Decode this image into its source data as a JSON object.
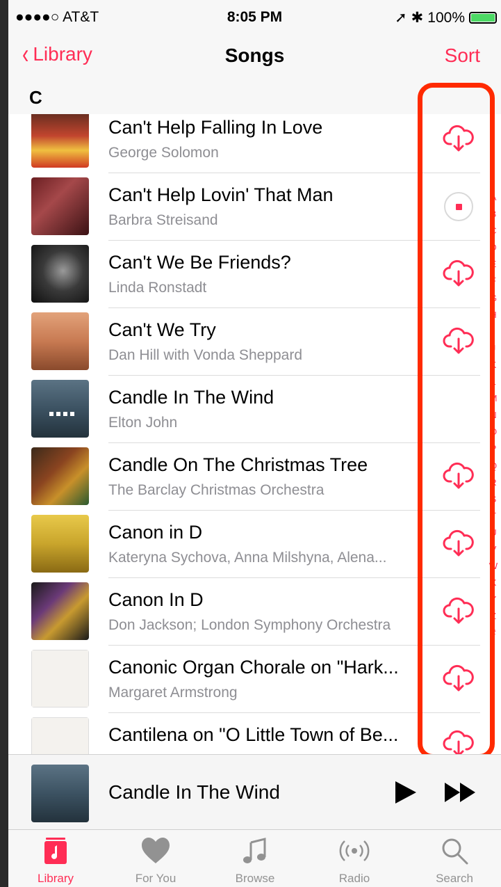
{
  "status_bar": {
    "carrier": "●●●●○ AT&T",
    "time": "8:05 PM",
    "battery": "100%"
  },
  "nav": {
    "back_label": "Library",
    "title": "Songs",
    "sort_label": "Sort"
  },
  "section_header": "C",
  "songs": [
    {
      "title": "Can't Help Falling In Love",
      "artist": "George Solomon",
      "status": "cloud-download-icon"
    },
    {
      "title": "Can't Help Lovin' That Man",
      "artist": "Barbra Streisand",
      "status": "stop-download-icon"
    },
    {
      "title": "Can't We Be Friends?",
      "artist": "Linda Ronstadt",
      "status": "cloud-download-icon"
    },
    {
      "title": "Can't We Try",
      "artist": "Dan Hill with Vonda Sheppard",
      "status": "cloud-download-icon"
    },
    {
      "title": "Candle In The Wind",
      "artist": "Elton John",
      "status": "now-playing-icon"
    },
    {
      "title": "Candle On The Christmas Tree",
      "artist": "The Barclay Christmas Orchestra",
      "status": "cloud-download-icon"
    },
    {
      "title": "Canon in D",
      "artist": "Kateryna Sychova, Anna Milshyna, Alena...",
      "status": "cloud-download-icon"
    },
    {
      "title": "Canon In D",
      "artist": "Don Jackson; London Symphony Orchestra",
      "status": "cloud-download-icon"
    },
    {
      "title": "Canonic Organ Chorale on \"Hark...",
      "artist": "Margaret Armstrong",
      "status": "cloud-download-icon"
    },
    {
      "title": "Cantilena on \"O Little Town of Be...",
      "artist": "",
      "status": "cloud-download-icon"
    }
  ],
  "index_letters": [
    "A",
    "B",
    "C",
    "D",
    "E",
    "F",
    "G",
    "H",
    "I",
    "J",
    "K",
    "L",
    "M",
    "N",
    "O",
    "P",
    "Q",
    "R",
    "S",
    "T",
    "U",
    "V",
    "W",
    "X",
    "Y",
    "Z",
    "#"
  ],
  "mini_player": {
    "title": "Candle In The Wind"
  },
  "tabs": [
    {
      "label": "Library",
      "icon": "library-icon",
      "active": true
    },
    {
      "label": "For You",
      "icon": "heart-icon",
      "active": false
    },
    {
      "label": "Browse",
      "icon": "music-note-icon",
      "active": false
    },
    {
      "label": "Radio",
      "icon": "radio-icon",
      "active": false
    },
    {
      "label": "Search",
      "icon": "search-icon",
      "active": false
    }
  ],
  "colors": {
    "accent": "#ff2d55",
    "highlight": "#ff2a00"
  }
}
